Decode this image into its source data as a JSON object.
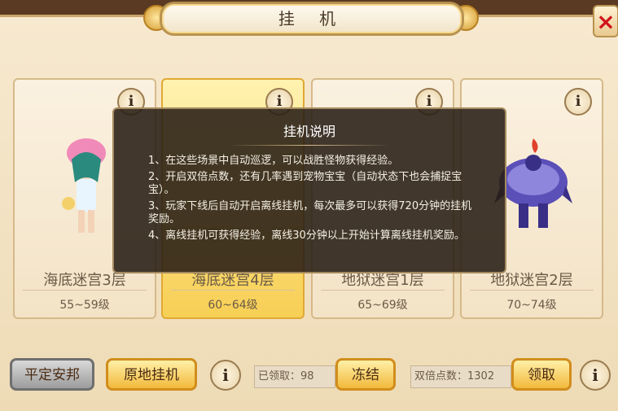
{
  "title": "挂 机",
  "close_icon": "×",
  "cards": [
    {
      "name": "海底迷宫3层",
      "level": "55~59级"
    },
    {
      "name": "海底迷宫4层",
      "level": "60~64级"
    },
    {
      "name": "地狱迷宫1层",
      "level": "65~69级"
    },
    {
      "name": "地狱迷宫2层",
      "level": "70~74级"
    }
  ],
  "info_glyph": "i",
  "tooltip": {
    "title": "挂机说明",
    "lines": [
      "1、在这些场景中自动巡逻，可以战胜怪物获得经验。",
      "2、开启双倍点数，还有几率遇到宠物宝宝（自动状态下也会捕捉宝宝）。",
      "3、玩家下线后自动开启离线挂机，每次最多可以获得720分钟的挂机奖励。",
      "4、离线挂机可获得经验，离线30分钟以上开始计算离线挂机奖励。"
    ]
  },
  "bottom": {
    "pingding_label": "平定安邦",
    "yuandi_label": "原地挂机",
    "received_label": "已领取：98",
    "freeze_label": "冻结",
    "double_points_label": "双倍点数：1302",
    "claim_label": "领取"
  }
}
